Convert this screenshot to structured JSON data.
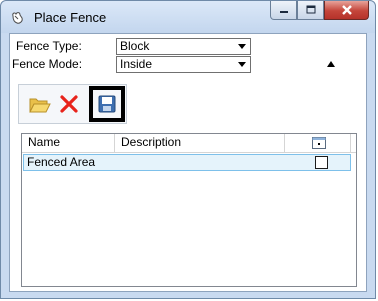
{
  "window": {
    "title": "Place Fence",
    "colors": {
      "frame": "#c9daf0",
      "close_button": "#c4453a",
      "selection_fill": "#e5f3fb",
      "selection_border": "#7dc0ea",
      "delete_icon": "#e8231b",
      "open_folder_icon": "#f1c84a"
    }
  },
  "settings": {
    "fence_type": {
      "label": "Fence Type:",
      "value": "Block"
    },
    "fence_mode": {
      "label": "Fence Mode:",
      "value": "Inside"
    }
  },
  "toolbar": {
    "icons": [
      "open-folder-icon",
      "delete-icon",
      "save-icon"
    ]
  },
  "fence_list": {
    "columns": [
      "Name",
      "Description"
    ],
    "rows": [
      {
        "name": "Fenced Area",
        "description": "",
        "checked": false
      }
    ]
  }
}
